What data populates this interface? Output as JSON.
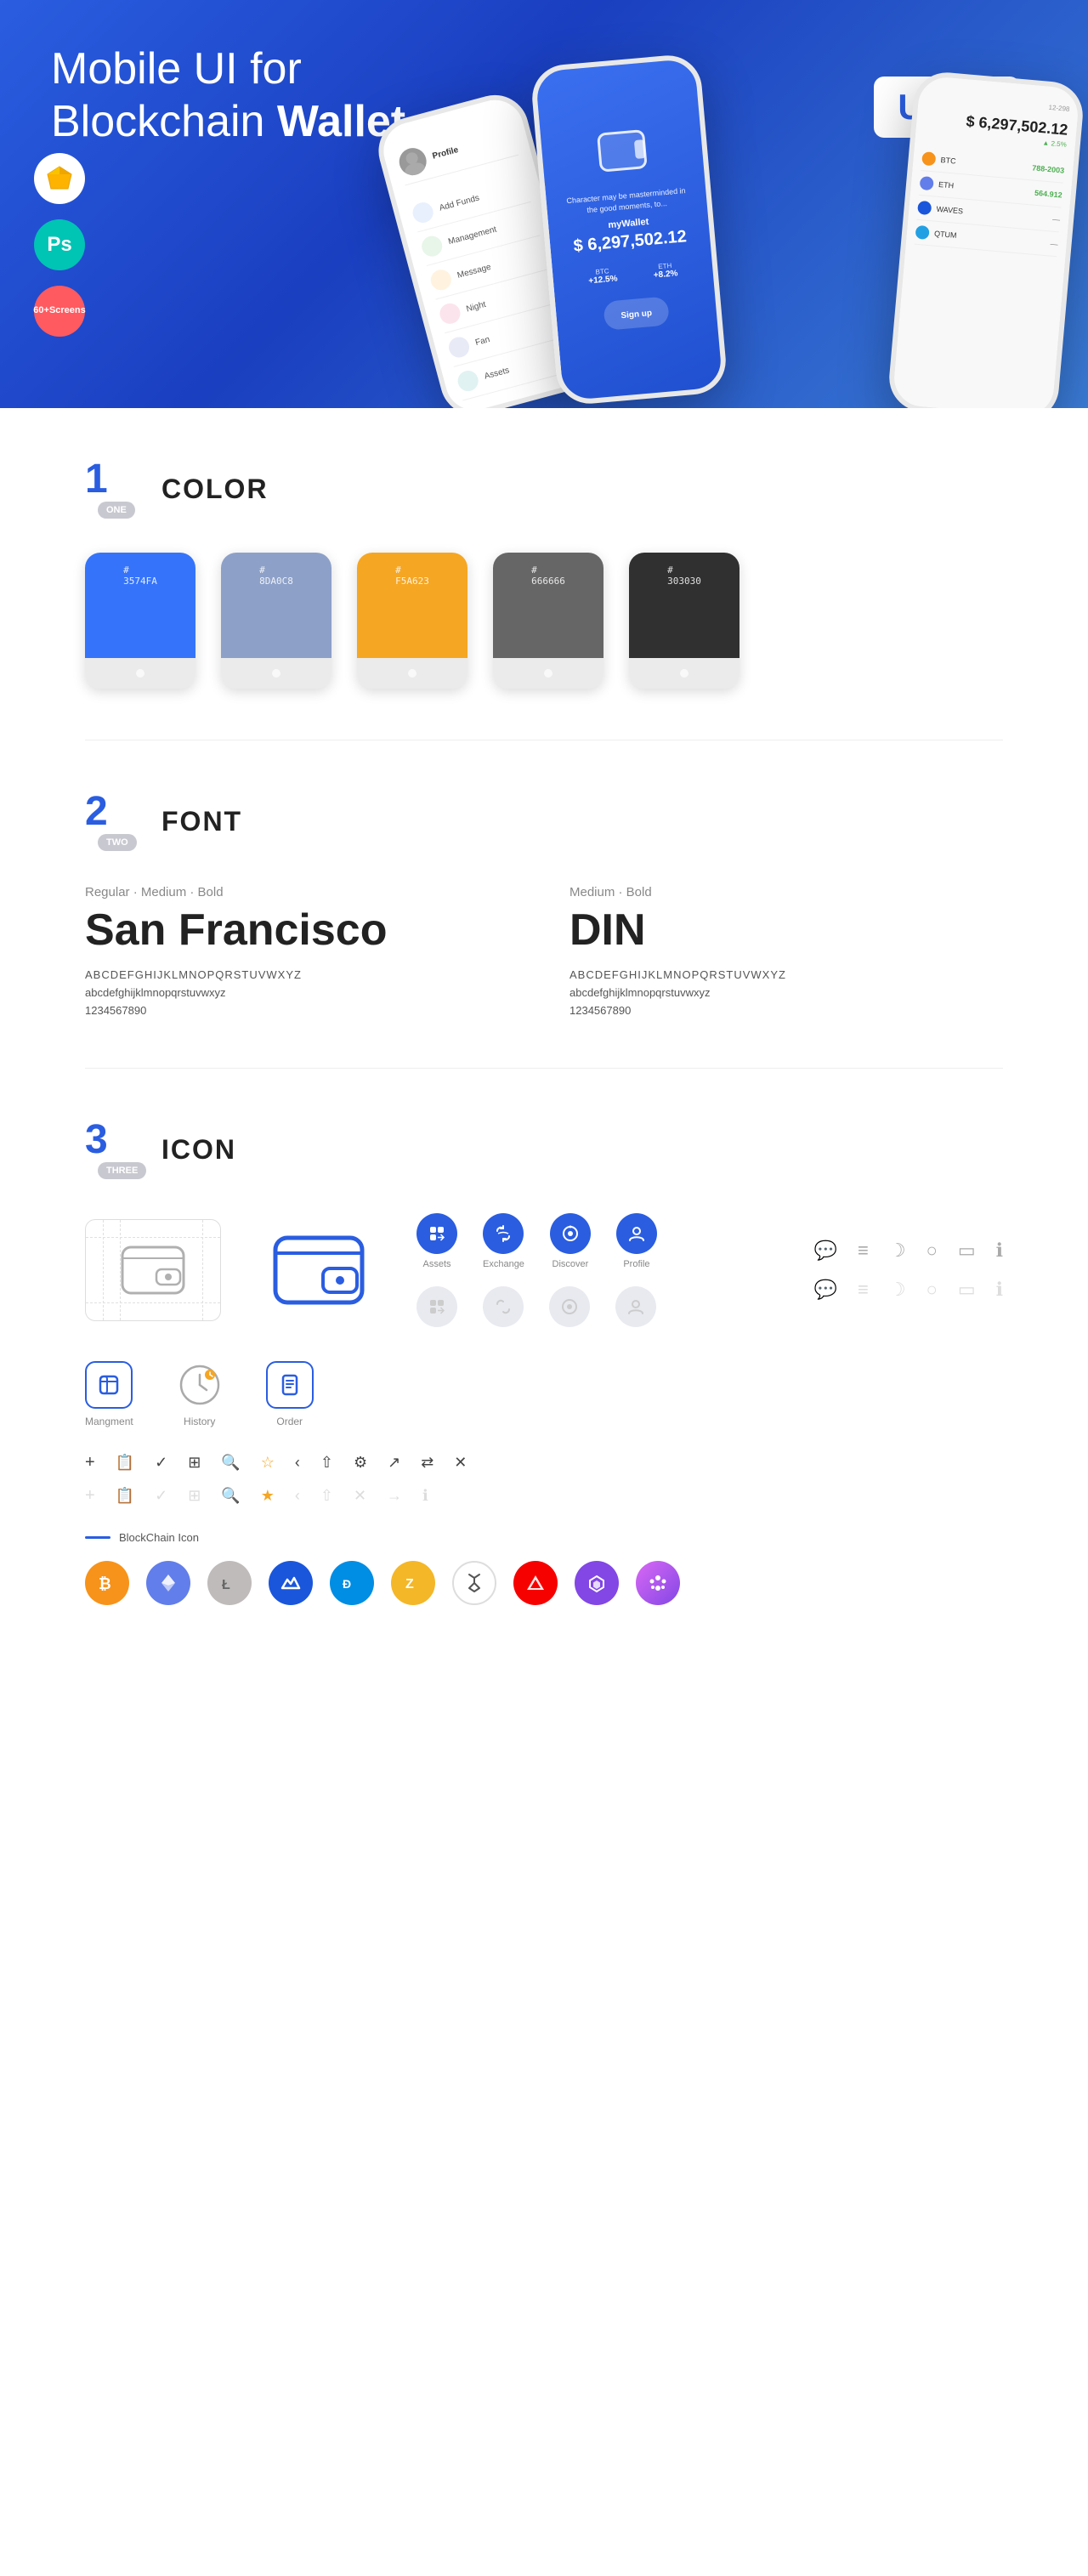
{
  "hero": {
    "title_regular": "Mobile UI for Blockchain ",
    "title_bold": "Wallet",
    "badge": "UI Kit",
    "badge_sketch": "◈",
    "badge_ps": "Ps",
    "badge_screens_line1": "60+",
    "badge_screens_line2": "Screens"
  },
  "sections": {
    "color": {
      "number": "1",
      "word": "ONE",
      "title": "COLOR",
      "swatches": [
        {
          "hex": "#3574FA",
          "display": "3574FA",
          "color": "#3574FA"
        },
        {
          "hex": "#8DA0C8",
          "display": "8DA0C8",
          "color": "#8DA0C8"
        },
        {
          "hex": "#F5A623",
          "display": "F5A623",
          "color": "#F5A623"
        },
        {
          "hex": "#666666",
          "display": "666666",
          "color": "#666666"
        },
        {
          "hex": "#303030",
          "display": "303030",
          "color": "#303030"
        }
      ]
    },
    "font": {
      "number": "2",
      "word": "TWO",
      "title": "FONT",
      "left": {
        "styles": "Regular · Medium · Bold",
        "name": "San Francisco",
        "uppercase": "ABCDEFGHIJKLMNOPQRSTUVWXYZ",
        "lowercase": "abcdefghijklmnopqrstuvwxyz",
        "numbers": "1234567890"
      },
      "right": {
        "styles": "Medium · Bold",
        "name": "DIN",
        "uppercase": "ABCDEFGHIJKLMNOPQRSTUVWXYZ",
        "lowercase": "abcdefghijklmnopqrstuvwxyz",
        "numbers": "1234567890"
      }
    },
    "icon": {
      "number": "3",
      "word": "THREE",
      "title": "ICON",
      "icon_labels": [
        "Assets",
        "Exchange",
        "Discover",
        "Profile"
      ],
      "bottom_labels": [
        "Mangment",
        "History",
        "Order"
      ],
      "blockchain_label": "BlockChain Icon"
    }
  }
}
